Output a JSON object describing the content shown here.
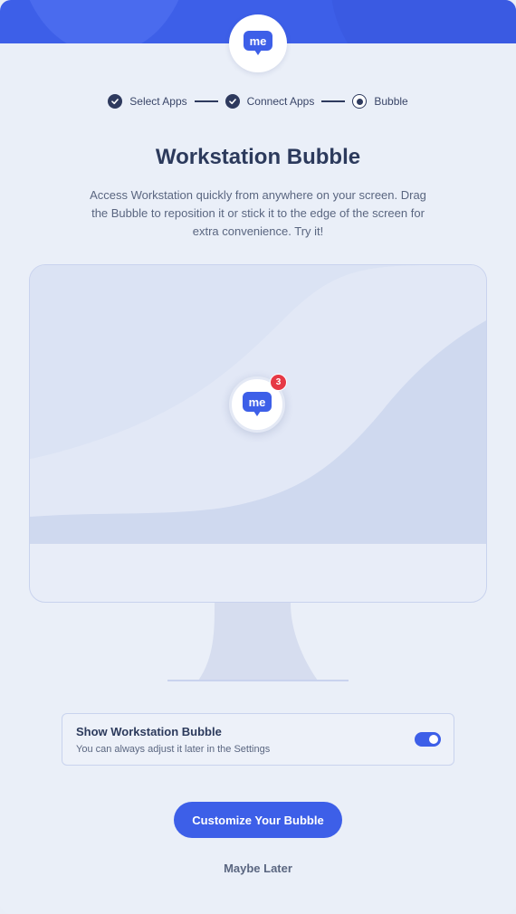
{
  "logo": {
    "icon": "me-chat-icon",
    "text": "me"
  },
  "stepper": {
    "steps": [
      {
        "label": "Select Apps",
        "state": "done"
      },
      {
        "label": "Connect Apps",
        "state": "done"
      },
      {
        "label": "Bubble",
        "state": "current"
      }
    ]
  },
  "main": {
    "title": "Workstation Bubble",
    "description": "Access Workstation quickly from anywhere on your screen. Drag the Bubble to reposition it or stick it to the edge of the screen for extra convenience. Try it!"
  },
  "bubble": {
    "icon": "me-chat-icon",
    "text": "me",
    "badge_count": "3"
  },
  "toggle": {
    "title": "Show Workstation Bubble",
    "subtitle": "You can always adjust it later in the Settings",
    "enabled": true
  },
  "actions": {
    "primary_label": "Customize Your Bubble",
    "secondary_label": "Maybe Later"
  },
  "colors": {
    "accent": "#3d5fe8",
    "badge": "#e63946",
    "text_dark": "#2c3a5c"
  }
}
